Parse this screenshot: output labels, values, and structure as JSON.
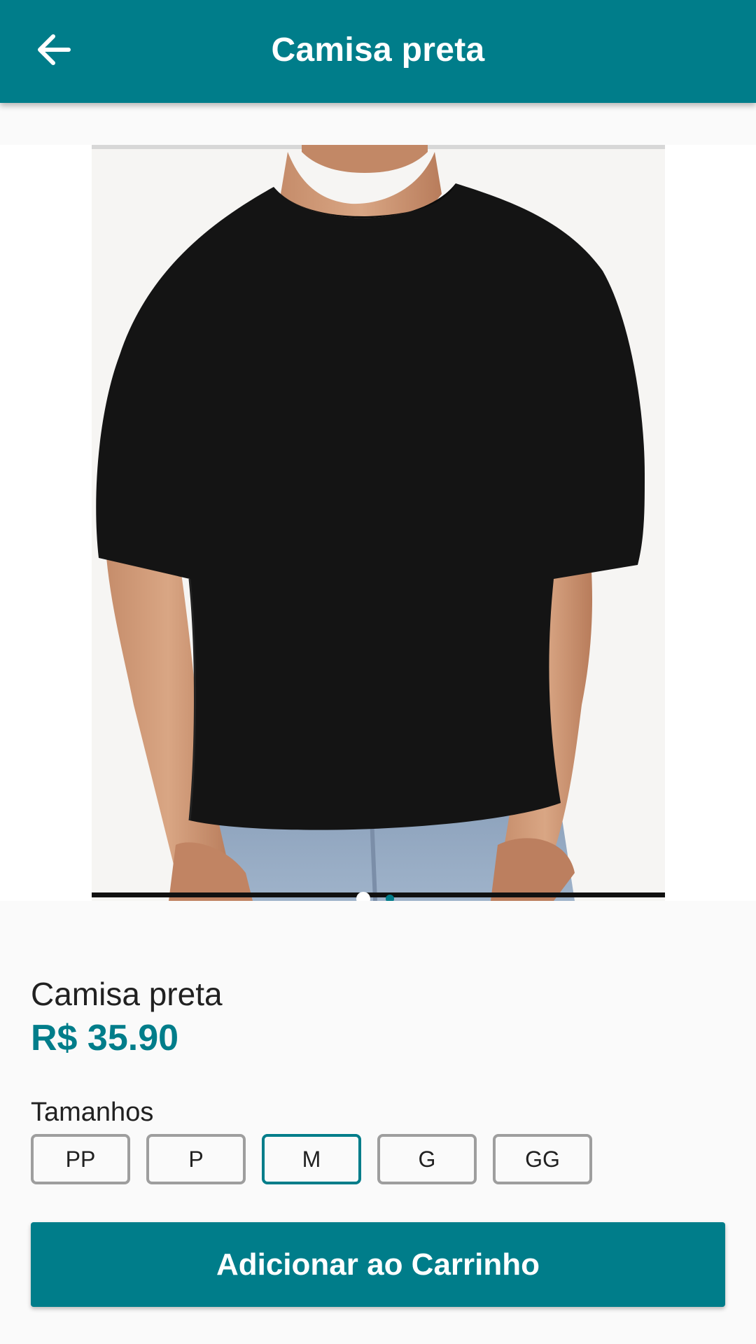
{
  "appbar": {
    "title": "Camisa preta",
    "back_icon": "arrow-left-icon"
  },
  "gallery": {
    "image_alt": "black t-shirt product photo",
    "page_count": 2,
    "active_page": 1
  },
  "product": {
    "name": "Camisa preta",
    "price": "R$ 35.90"
  },
  "sizes": {
    "label": "Tamanhos",
    "options": [
      "PP",
      "P",
      "M",
      "G",
      "GG"
    ],
    "selected": "M"
  },
  "actions": {
    "add_to_cart_label": "Adicionar ao Carrinho"
  },
  "colors": {
    "primary": "#007d8a",
    "background": "#fafafa",
    "text": "#212121",
    "size_border": "#9e9e9e"
  }
}
